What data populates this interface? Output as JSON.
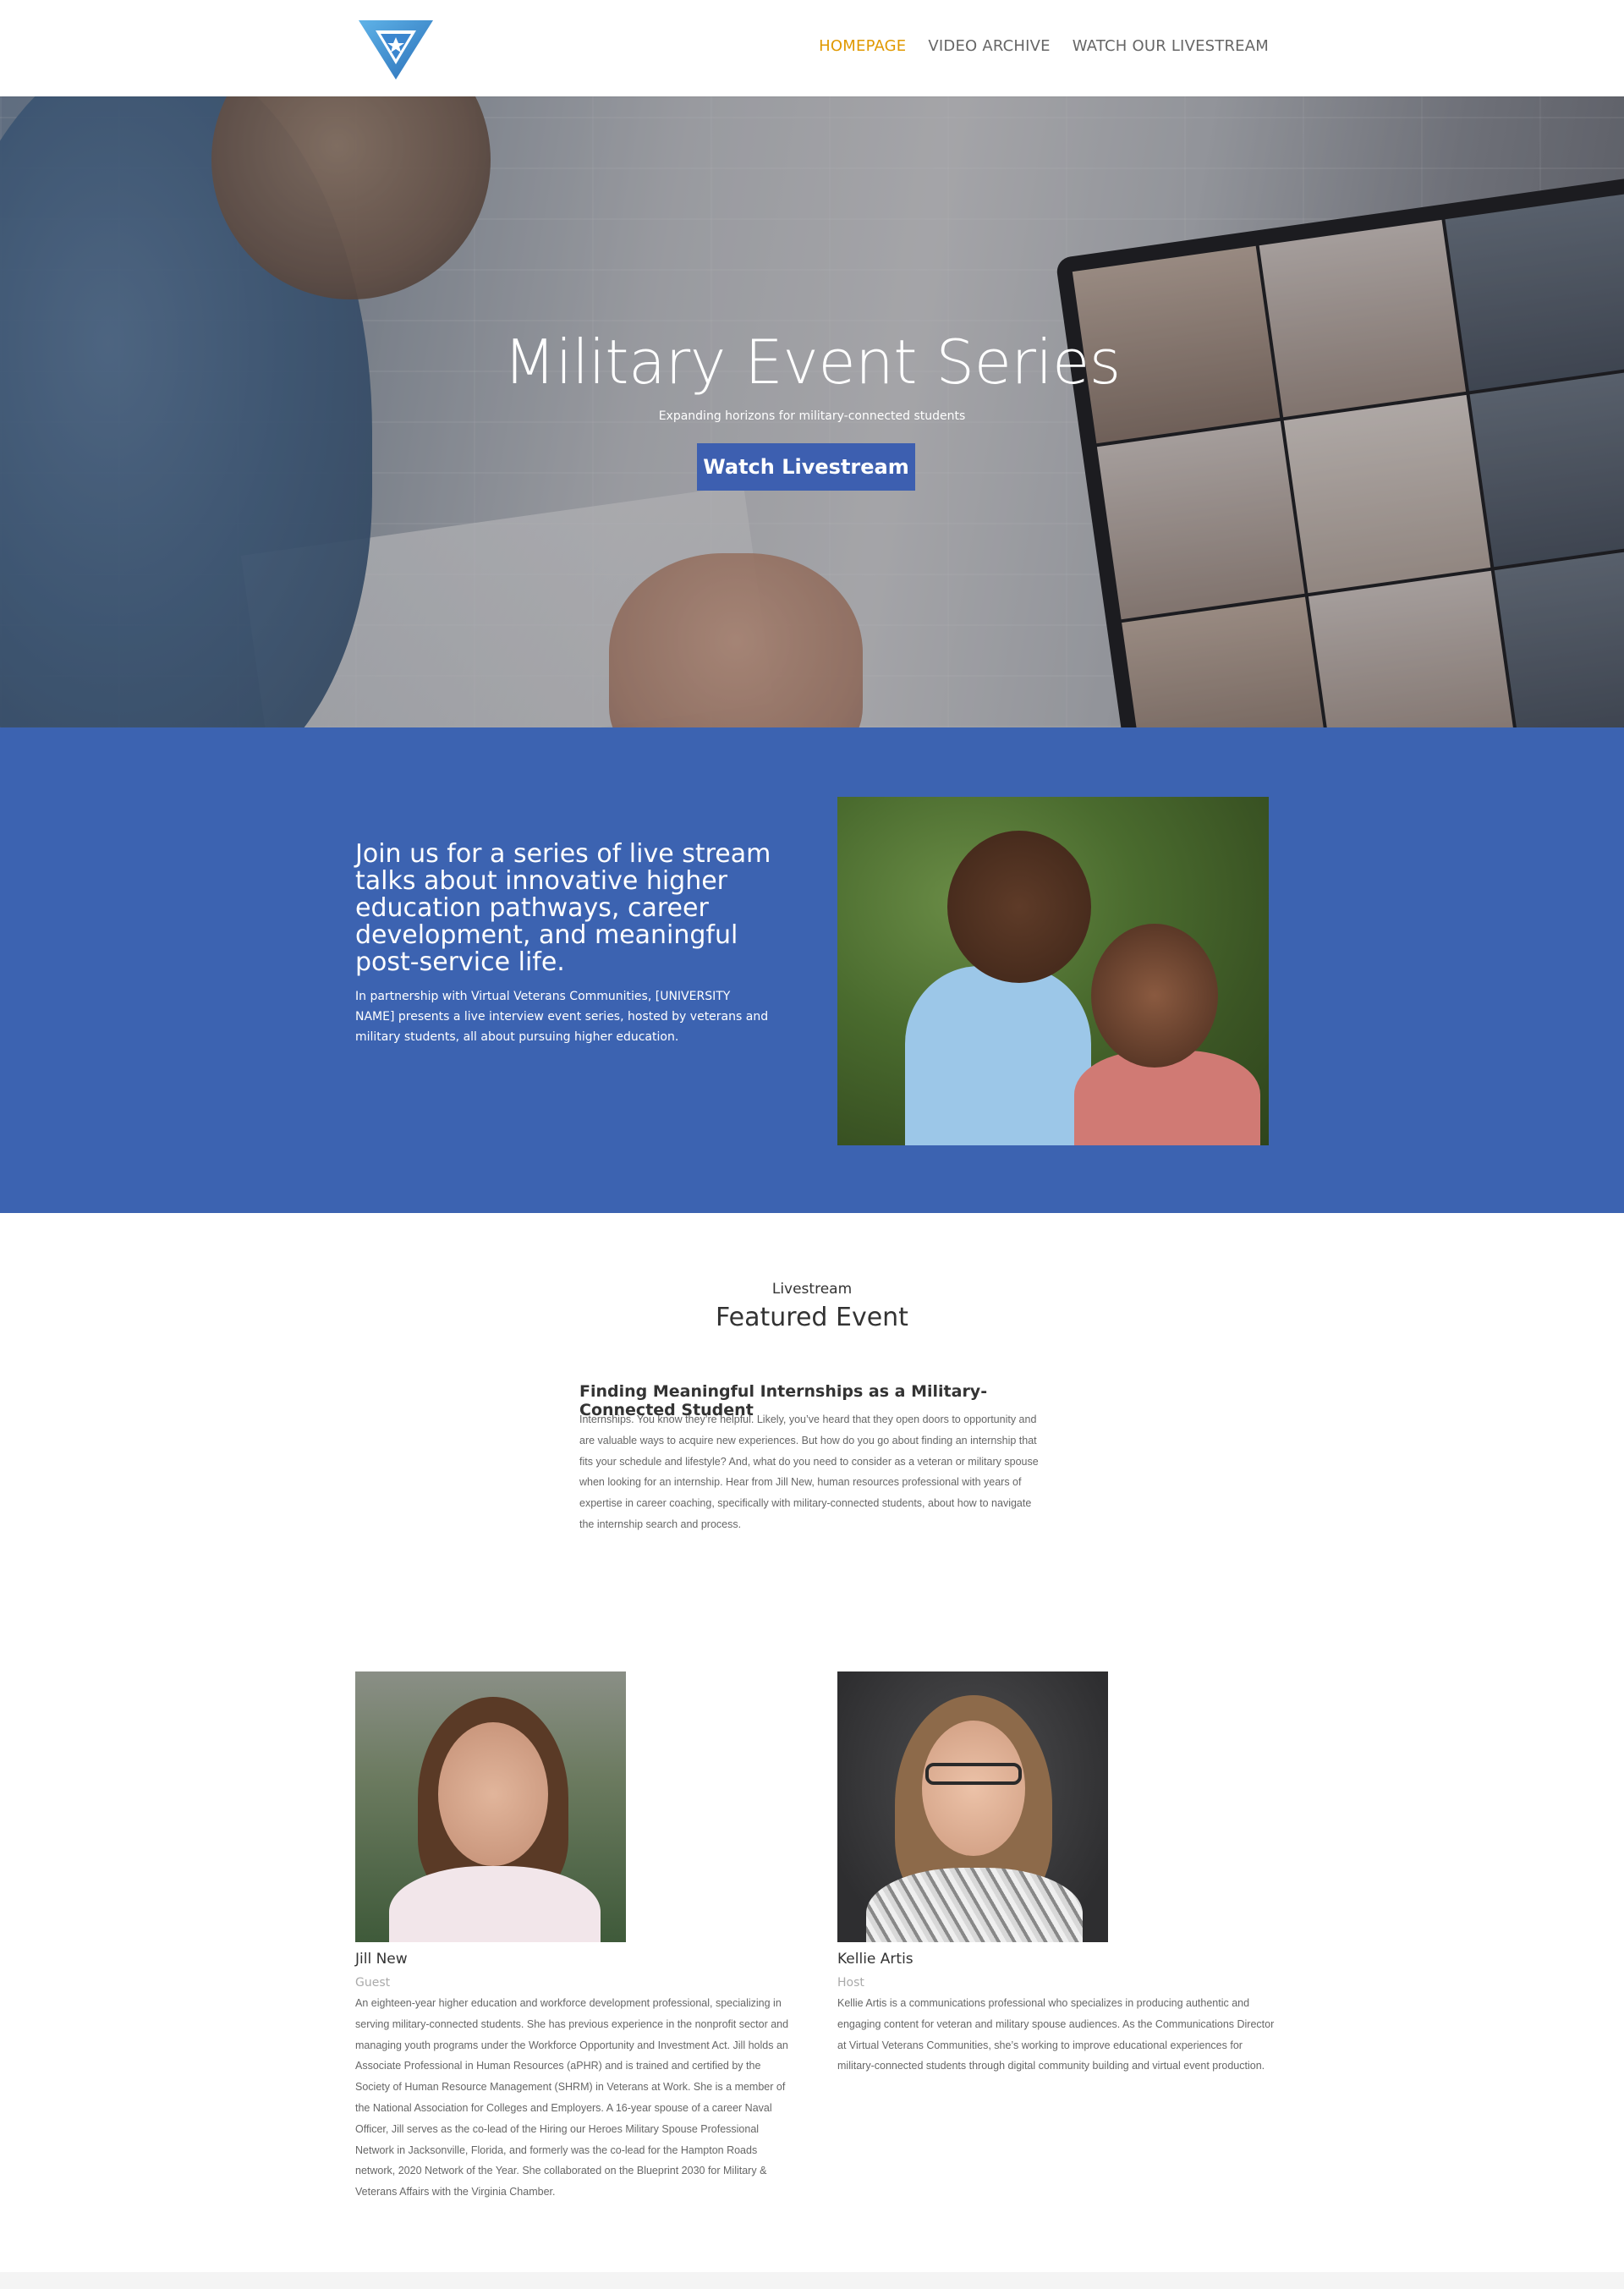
{
  "nav": {
    "items": [
      {
        "label": "HOMEPAGE",
        "active": true
      },
      {
        "label": "VIDEO ARCHIVE",
        "active": false
      },
      {
        "label": "WATCH OUR LIVESTREAM",
        "active": false
      }
    ]
  },
  "hero": {
    "title": "Military Event Series",
    "subtitle": "Expanding horizons for military-connected students",
    "button_label": "Watch Livestream"
  },
  "intro": {
    "heading": "Join us for a series of live stream talks about innovative higher education pathways, career development, and meaningful post-service life.",
    "paragraph": "In partnership with Virtual Veterans Communities, [UNIVERSITY NAME] presents a live interview event series, hosted by veterans and military students, all about pursuing higher education."
  },
  "featured": {
    "kicker": "Livestream",
    "title": "Featured Event",
    "event_title": "Finding Meaningful Internships as a Military-Connected Student",
    "event_description": "Internships. You know they’re helpful. Likely, you’ve heard that they open doors to opportunity and are valuable ways to acquire new experiences. But how do you go about finding an internship that fits your schedule and lifestyle? And, what do you need to consider as a veteran or military spouse when looking for an internship. Hear from Jill New, human resources professional with years of expertise in career coaching, specifically with military-connected students, about how to navigate the internship search and process."
  },
  "people": [
    {
      "name": "Jill New",
      "role": "Guest",
      "bio": "An eighteen-year higher education and workforce development professional, specializing in serving military-connected students. She has previous experience in the nonprofit sector and managing youth programs under the Workforce Opportunity and Investment Act. Jill holds an Associate Professional in Human Resources (aPHR) and is trained and certified by the Society of Human Resource Management (SHRM) in Veterans at Work. She is a member of the National Association for Colleges and Employers. A 16-year spouse of a career Naval Officer, Jill serves as the co-lead of the Hiring our Heroes Military Spouse Professional Network in Jacksonville, Florida, and formerly was the co-lead for the Hampton Roads network, 2020 Network of the Year. She collaborated on the Blueprint 2030 for Military & Veterans Affairs with the Virginia Chamber."
    },
    {
      "name": "Kellie Artis",
      "role": "Host",
      "bio": "Kellie Artis is a communications professional who specializes in producing authentic and engaging content for veteran and military spouse audiences. As the Communications Director at Virtual Veterans Communities, she’s working to improve educational experiences for military-connected students through digital community building and virtual event production."
    }
  ],
  "colors": {
    "accent": "#e09900",
    "brand_blue": "#3c63b1",
    "button_blue": "#3d5fb0"
  },
  "icons": {
    "logo": "triangle-v-star-logo"
  }
}
